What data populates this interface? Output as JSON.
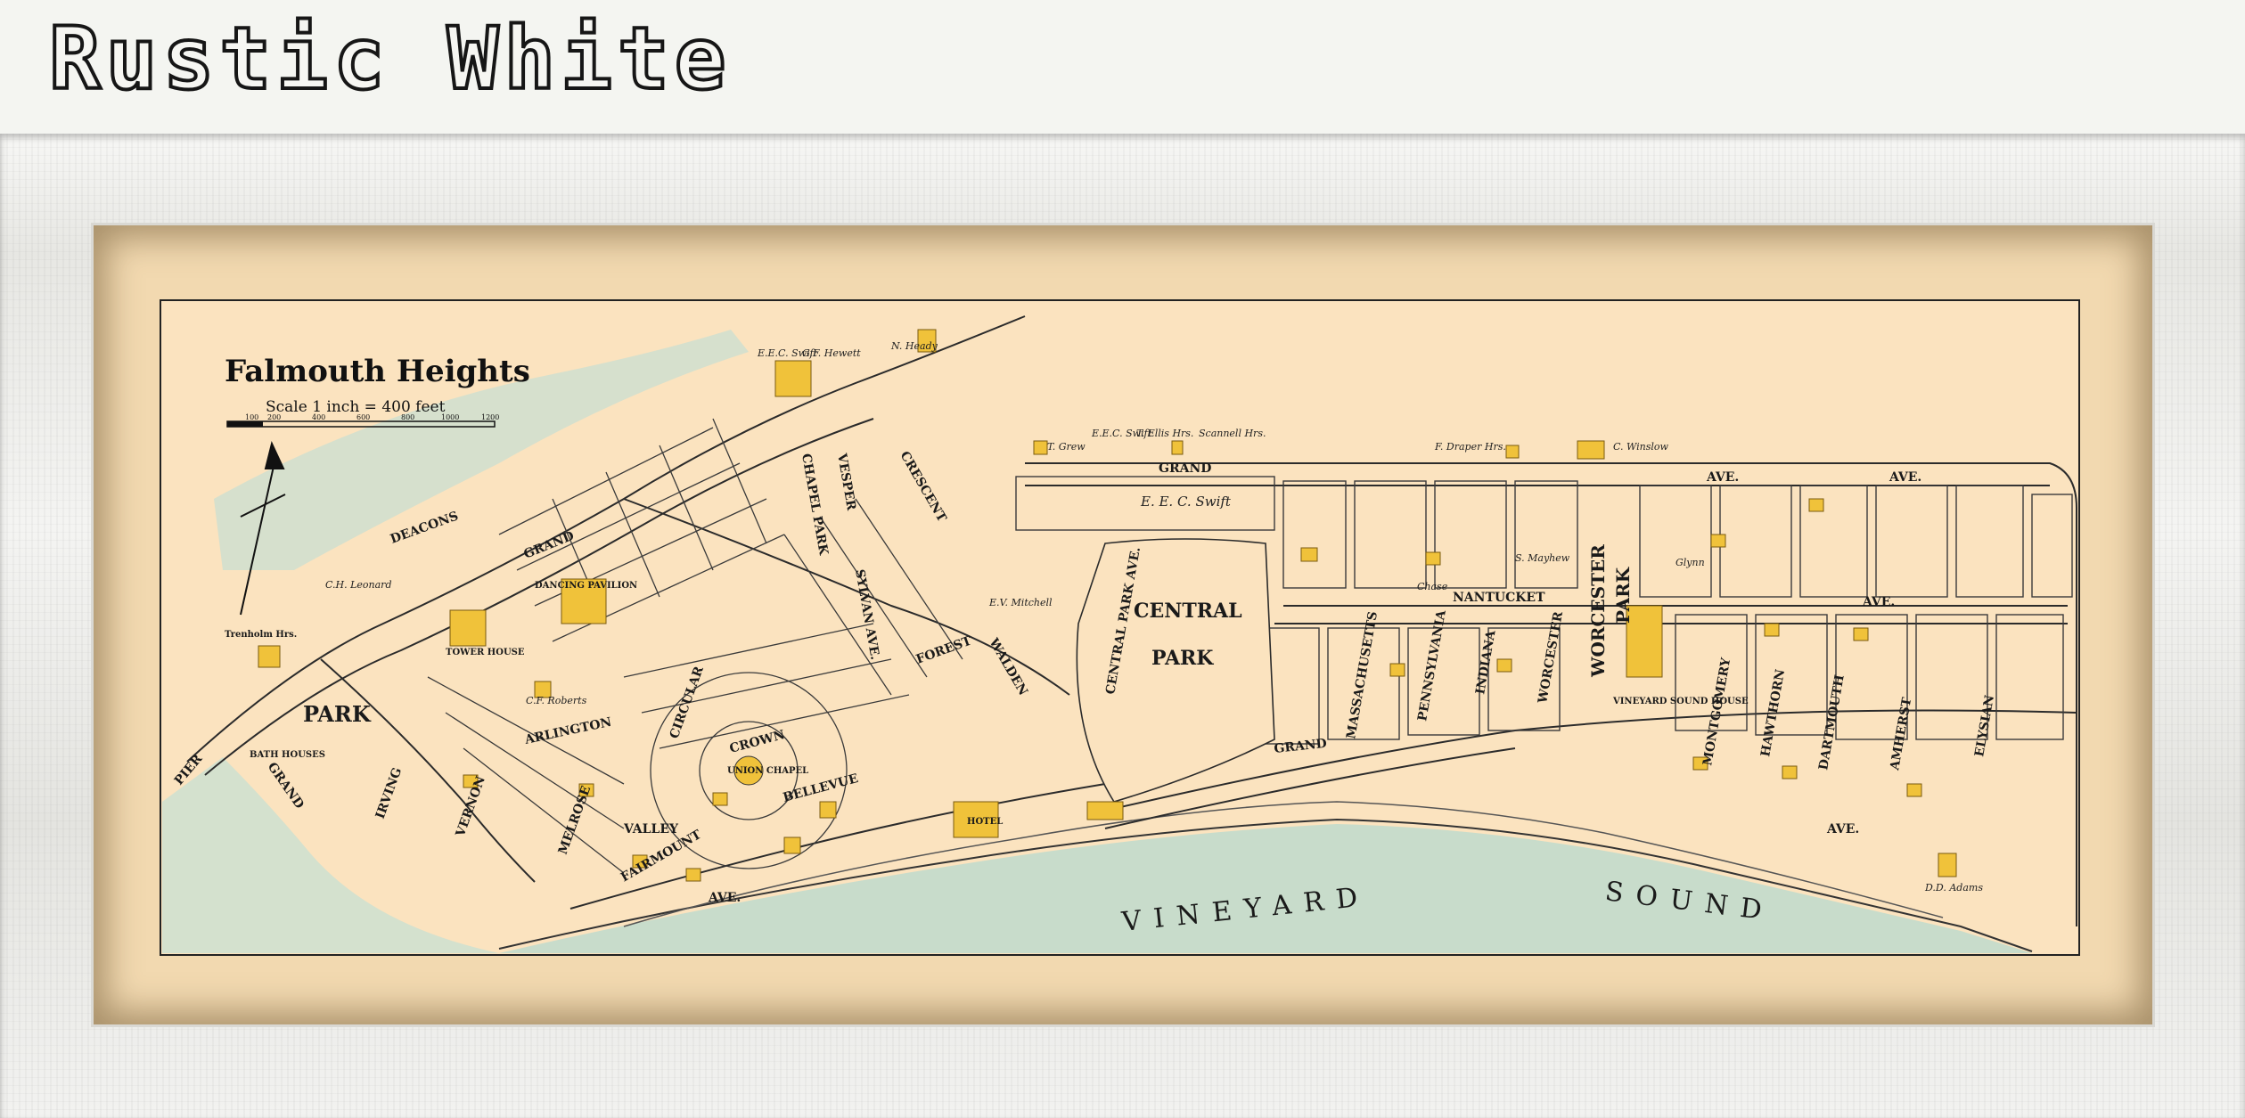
{
  "banner": {
    "title": "Rustic White"
  },
  "map": {
    "title": "Falmouth Heights",
    "scale_text": "Scale 1 inch = 400 feet",
    "scale_ticks": [
      "100",
      "200",
      "400",
      "600",
      "800",
      "1000",
      "1200"
    ],
    "water": {
      "vineyard": "VINEYARD",
      "sound": "SOUND"
    },
    "parks": {
      "central_1": "CENTRAL",
      "central_2": "PARK",
      "park_west": "PARK",
      "worcester_1": "WORCESTER",
      "worcester_2": "PARK"
    },
    "streets": {
      "grand_ave_north": "GRAND",
      "ave_north": "AVE.",
      "ave_east_end": "AVE.",
      "grand_ave_south": "GRAND",
      "ave_south": "AVE.",
      "nantucket": "NANTUCKET",
      "nantucket_ave": "AVE.",
      "grand_west": "GRAND",
      "grand_west_2": "GRAND",
      "deacons": "DEACONS",
      "arlington": "ARLINGTON",
      "irving": "IRVING",
      "pier": "PIER",
      "crescent": "CRESCENT",
      "chapel_park": "CHAPEL PARK",
      "vesper": "VESPER",
      "sylvan": "SYLVAN AVE.",
      "forest": "FOREST",
      "walden": "WALDEN",
      "bellevue": "BELLEVUE",
      "central_park_ave": "CENTRAL PARK AVE.",
      "massachusetts": "MASSACHUSETTS",
      "pennsylvania": "PENNSYLVANIA",
      "indiana": "INDIANA",
      "worcester": "WORCESTER",
      "montgomery": "MONTGOMERY",
      "hawthorn": "HAWTHORN",
      "dartmouth": "DARTMOUTH",
      "amherst": "AMHERST",
      "elysian": "ELYSIAN",
      "melrose": "MELROSE",
      "vernon": "VERNON",
      "fairmount": "FAIRMOUNT",
      "circular": "CIRCULAR",
      "crown": "CROWN",
      "vanvalley": "VALLEY",
      "ave_bottom": "AVE."
    },
    "landmarks": {
      "tower_house": "TOWER HOUSE",
      "bath_houses": "BATH HOUSES",
      "dancing_pavilion": "DANCING PAVILION",
      "vineyard_sound_house": "VINEYARD SOUND HOUSE",
      "union_chapel": "UNION CHAPEL",
      "hotel": "HOTEL",
      "trenholm": "Trenholm Hrs."
    },
    "owners": {
      "grew": "T. Grew",
      "eec_swift_1": "E.E.C. Swift",
      "ellis": "T. Ellis Hrs.",
      "scannell": "Scannell Hrs.",
      "draper": "F. Draper Hrs.",
      "winslow": "C. Winslow",
      "eec_swift_box": "E. E. C. Swift",
      "eec_swift_top": "E.E.C. Swift",
      "hewett": "G.F. Hewett",
      "heady": "N. Heady",
      "dd_adams": "D.D. Adams",
      "roberts": "C.F. Roberts",
      "mitchell": "E.V. Mitchell",
      "chase": "Chase",
      "mayhew": "S. Mayhew",
      "glynn": "Glynn",
      "leonard": "C.H. Leonard"
    }
  }
}
